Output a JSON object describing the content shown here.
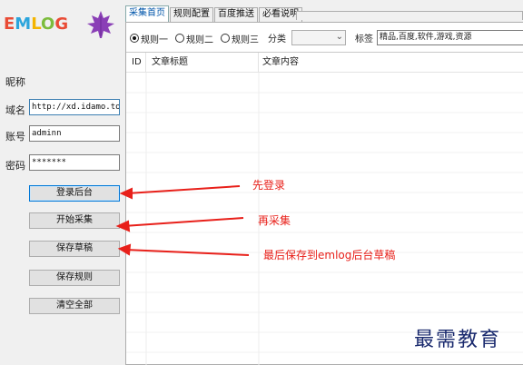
{
  "logo": {
    "parts": [
      "E",
      "M",
      "L",
      "O",
      "G"
    ]
  },
  "form": {
    "nickname_label": "昵称",
    "domain_label": "域名",
    "domain_value": "http://xd.idamo.top",
    "account_label": "账号",
    "account_value": "adminn",
    "password_label": "密码",
    "password_value": "*******"
  },
  "buttons": {
    "login": "登录后台",
    "start_collect": "开始采集",
    "save_draft": "保存草稿",
    "save_rule": "保存规则",
    "clear_all": "清空全部"
  },
  "tabs": [
    "采集首页",
    "规则配置",
    "百度推送",
    "必看说明"
  ],
  "options": {
    "rules": [
      "规则一",
      "规则二",
      "规则三"
    ],
    "selected_rule": "规则一",
    "category_label": "分类",
    "category_value": "",
    "tags_label": "标签",
    "tags_value": "精品,百度,软件,游戏,资源"
  },
  "table": {
    "columns": [
      "ID",
      "文章标题",
      "文章内容"
    ]
  },
  "annotations": {
    "first_login": "先登录",
    "then_collect": "再采集",
    "finally_save": "最后保存到emlog后台草稿"
  },
  "watermark": "最需教育",
  "colors": {
    "annotation": "#e8201a",
    "watermark": "#1a2a6e",
    "active_tab_text": "#0055aa"
  }
}
